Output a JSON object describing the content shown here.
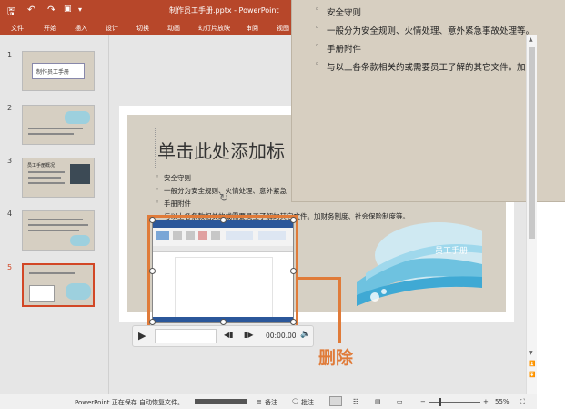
{
  "titlebar": {
    "save_icon": "save-icon",
    "undo_icon": "undo-icon",
    "redo_icon": "redo-icon",
    "title": "制作员工手册.pptx - PowerPoint"
  },
  "ribbon": {
    "tabs": [
      "文件",
      "开始",
      "插入",
      "设计",
      "切换",
      "动画",
      "幻灯片放映",
      "审阅",
      "视图"
    ]
  },
  "thumbnails": {
    "items": [
      {
        "num": "1",
        "text": "制作员工手册"
      },
      {
        "num": "2",
        "text": ""
      },
      {
        "num": "3",
        "text": "员工手册概况"
      },
      {
        "num": "4",
        "text": ""
      },
      {
        "num": "5",
        "text": ""
      }
    ]
  },
  "slide": {
    "title": "单击此处添加标",
    "bullets": [
      "安全守则",
      "一般分为安全规则、火情处理、意外紧急",
      "手册附件",
      "与以上各条款相关的或需要员工了解的其它文件。加财务制度、社会保险制度等。"
    ],
    "logo_text": "员工手册"
  },
  "popup": {
    "bullets": [
      "安全守则",
      "一般分为安全规则、火情处理、意外紧急事故处理等。",
      "手册附件",
      "与以上各条款相关的或需要员工了解的其它文件。加财"
    ]
  },
  "media_controls": {
    "time": "00:00.00"
  },
  "annotation": {
    "label": "删除",
    "color": "#e07b39"
  },
  "statusbar": {
    "status_text": "PowerPoint 正在保存 自动恢复文件。",
    "notes_label": "备注",
    "comments_label": "批注",
    "zoom": "55%"
  },
  "colors": {
    "ribbon": "#b7472a",
    "selection": "#d24726"
  }
}
